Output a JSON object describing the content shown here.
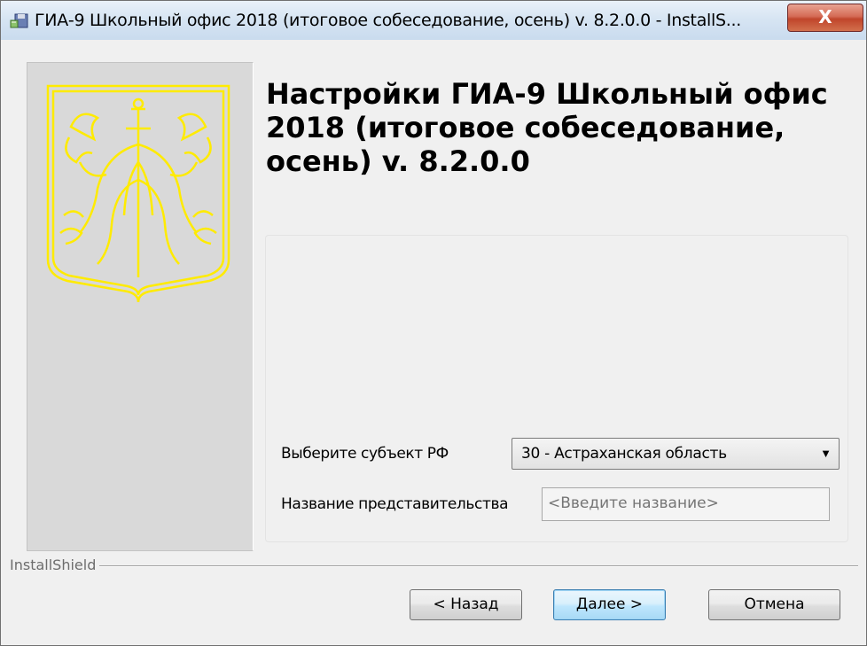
{
  "window": {
    "title": "ГИА-9 Школьный офис 2018 (итоговое собеседование, осень) v. 8.2.0.0 - InstallS...",
    "close_glyph": "X",
    "icon": "installer-icon"
  },
  "heading": "Настройки ГИА-9 Школьный офис 2018 (итоговое собеседование, осень) v. 8.2.0.0",
  "form": {
    "region_label": "Выберите субъект РФ",
    "region_value": "30 - Астраханская область",
    "office_label": "Название представительства",
    "office_placeholder": "<Введите название>"
  },
  "footer": {
    "brand": "InstallShield",
    "back_label": "< Назад",
    "next_label": "Далее >",
    "cancel_label": "Отмена"
  },
  "colors": {
    "emblem": "#ffeb00",
    "panel": "#d9d9d9",
    "close_button": "#c7492e"
  }
}
